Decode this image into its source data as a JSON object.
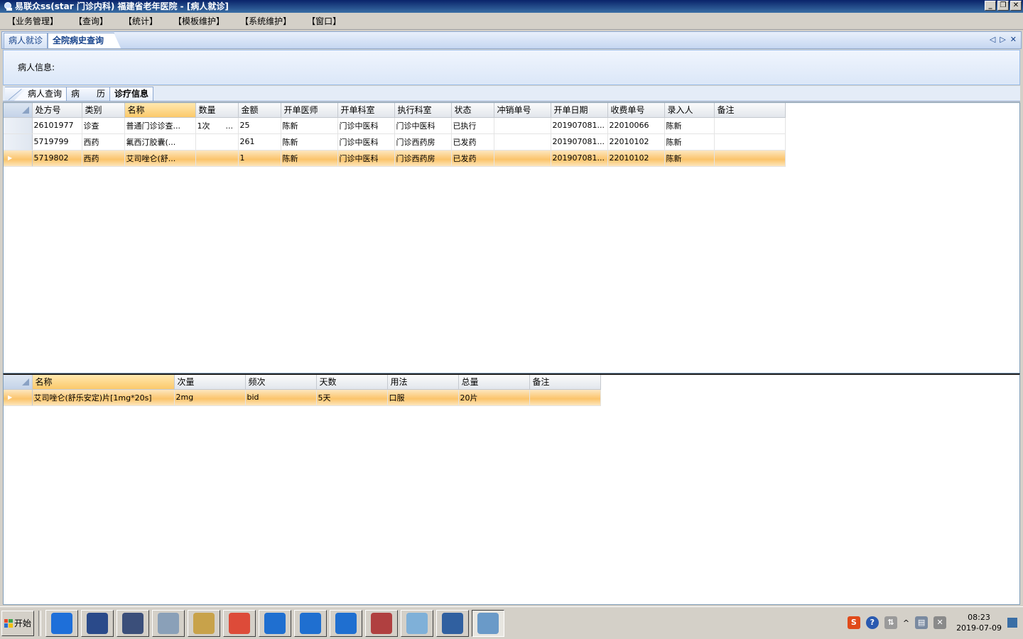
{
  "window": {
    "title": "易联众ss(star 门诊内科) 福建省老年医院 - [病人就诊]",
    "controls": [
      "_",
      "❐",
      "✕"
    ]
  },
  "menu": [
    "【业务管理】",
    "【查询】",
    "【统计】",
    "【模板维护】",
    "【系统维护】",
    "【窗口】"
  ],
  "doc_tabs": [
    {
      "label": "病人就诊",
      "active": false
    },
    {
      "label": "全院病史查询",
      "active": true
    }
  ],
  "doc_tab_controls": [
    "◁",
    "▷",
    "✕"
  ],
  "patient_info": {
    "label": "病人信息:"
  },
  "sub_tabs": [
    {
      "label": "病人查询",
      "active": false
    },
    {
      "label": "病　　历",
      "active": false
    },
    {
      "label": "诊疗信息",
      "active": true
    }
  ],
  "main_grid": {
    "columns": [
      "处方号",
      "类别",
      "名称",
      "数量",
      "金额",
      "开单医师",
      "开单科室",
      "执行科室",
      "状态",
      "冲销单号",
      "开单日期",
      "收费单号",
      "录入人",
      "备注"
    ],
    "sorted_column": 2,
    "rows": [
      [
        "26101977",
        "诊查",
        "普通门诊诊查...",
        "1次　　...",
        "25",
        "陈新",
        "门诊中医科",
        "门诊中医科",
        "已执行",
        "",
        "201907081...",
        "22010066",
        "陈新",
        ""
      ],
      [
        "5719799",
        "西药",
        "氟西汀胶囊(...",
        "",
        "261",
        "陈新",
        "门诊中医科",
        "门诊西药房",
        "已发药",
        "",
        "201907081...",
        "22010102",
        "陈新",
        ""
      ],
      [
        "5719802",
        "西药",
        "艾司唑仑(舒...",
        "",
        "1",
        "陈新",
        "门诊中医科",
        "门诊西药房",
        "已发药",
        "",
        "201907081...",
        "22010102",
        "陈新",
        ""
      ]
    ],
    "selected_row": 2
  },
  "detail_grid": {
    "columns": [
      "名称",
      "次量",
      "频次",
      "天数",
      "用法",
      "总量",
      "备注"
    ],
    "sorted_column": 0,
    "rows": [
      [
        "艾司唑仑(舒乐安定)片[1mg*20s]",
        "2mg",
        "bid",
        "5天",
        "口服",
        "20片",
        ""
      ]
    ],
    "selected_row": 0
  },
  "taskbar": {
    "start_label": "开始",
    "apps": [
      {
        "icon": "internet-explorer-icon",
        "color": "#1e6fd9"
      },
      {
        "icon": "sql-query-icon",
        "color": "#2a4a8a"
      },
      {
        "icon": "compass-icon",
        "color": "#3b4f7a"
      },
      {
        "icon": "calculator-icon",
        "color": "#8aa0b8"
      },
      {
        "icon": "file-cabinet-icon",
        "color": "#c8a24a"
      },
      {
        "icon": "chrome-icon",
        "color": "#dd4b39"
      },
      {
        "icon": "s-app-icon-1",
        "color": "#1f6fd0"
      },
      {
        "icon": "s-app-icon-2",
        "color": "#1f6fd0"
      },
      {
        "icon": "s-app-icon-3",
        "color": "#1f6fd0"
      },
      {
        "icon": "database-icon",
        "color": "#b04040"
      },
      {
        "icon": "notebook-icon",
        "color": "#7fb0d8"
      },
      {
        "icon": "sql-server-icon",
        "color": "#3060a0"
      },
      {
        "icon": "doctor-app-icon",
        "color": "#6a9ac8"
      }
    ],
    "pressed_app": 12,
    "tray": {
      "time": "08:23",
      "date": "2019-07-09"
    }
  }
}
